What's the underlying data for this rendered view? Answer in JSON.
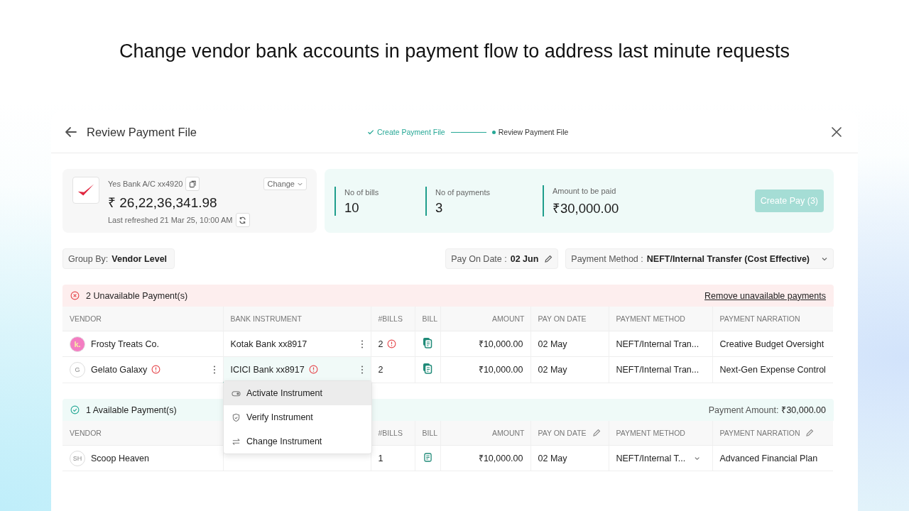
{
  "headline": "Change vendor bank accounts in payment flow to address last minute requests",
  "header": {
    "title": "Review Payment File",
    "steps": [
      {
        "label": "Create Payment File",
        "done": true
      },
      {
        "label": "Review Payment File",
        "done": false
      }
    ]
  },
  "account": {
    "name": "Yes Bank A/C xx4920",
    "balance": "₹ 26,22,36,341.98",
    "refreshed": "Last refreshed 21 Mar 25, 10:00 AM",
    "change_label": "Change"
  },
  "stats": [
    {
      "label": "No of bills",
      "value": "10"
    },
    {
      "label": "No of payments",
      "value": "3"
    },
    {
      "label": "Amount to be paid",
      "value": "₹30,000.00"
    }
  ],
  "create_button": {
    "label": "Create Pay (3)",
    "disabled": true
  },
  "filters": {
    "group_by": {
      "label": "Group By:",
      "value": "Vendor Level"
    },
    "pay_on_date": {
      "label": "Pay On Date :",
      "value": "02 Jun"
    },
    "payment_method": {
      "label": "Payment Method :",
      "value": "NEFT/Internal Transfer (Cost Effective)"
    }
  },
  "sections": [
    {
      "kind": "unavailable",
      "title": "2 Unavailable Payment(s)",
      "action": "Remove unavailable payments",
      "columns": [
        {
          "label": "VENDOR"
        },
        {
          "label": "BANK INSTRUMENT"
        },
        {
          "label": "#BILLS"
        },
        {
          "label": "BILL"
        },
        {
          "label": "AMOUNT"
        },
        {
          "label": "PAY ON DATE"
        },
        {
          "label": "PAYMENT METHOD"
        },
        {
          "label": "PAYMENT NARRATION"
        }
      ],
      "rows": [
        {
          "avatar": {
            "kind": "logo",
            "text": "k."
          },
          "vendor": "Frosty Treats Co.",
          "bank": "Kotak Bank xx8917",
          "bills": "2",
          "bills_warning": true,
          "bill": {
            "kind": "multi"
          },
          "amount": "₹10,000.00",
          "date": "02 May",
          "method": "NEFT/Internal Tran...",
          "narration": "Creative Budget Oversight"
        },
        {
          "avatar": {
            "kind": "initials",
            "text": "G"
          },
          "vendor": "Gelato Galaxy",
          "vendor_warning": true,
          "vendor_menu": true,
          "bank": "ICICI Bank xx8917",
          "bank_warning": true,
          "bank_selected": true,
          "bills": "2",
          "bill": {
            "kind": "multi"
          },
          "amount": "₹10,000.00",
          "date": "02 May",
          "method": "NEFT/Internal Tran...",
          "narration": "Next-Gen Expense Control"
        }
      ],
      "menu": [
        {
          "kind": "activate",
          "label": "Activate Instrument",
          "selected": true
        },
        {
          "kind": "verify",
          "label": "Verify Instrument",
          "selected": false
        },
        {
          "kind": "change",
          "label": "Change Instrument",
          "selected": false
        }
      ]
    },
    {
      "kind": "available",
      "title": "1 Available Payment(s)",
      "summary_label": "Payment Amount:",
      "summary_value": "₹30,000.00",
      "columns": [
        {
          "label": "VENDOR"
        },
        {},
        {
          "label": "#BILLS"
        },
        {
          "label": "BILL"
        },
        {
          "label": "AMOUNT"
        },
        {
          "label": "PAY ON DATE",
          "editable": true
        },
        {
          "label": "PAYMENT METHOD"
        },
        {
          "label": "PAYMENT NARRATION",
          "editable": true
        }
      ],
      "rows": [
        {
          "avatar": {
            "kind": "initials",
            "text": "SH"
          },
          "vendor": "Scoop Heaven",
          "bills": "1",
          "bill": {
            "kind": "single"
          },
          "amount": "₹10,000.00",
          "date": "02 May",
          "method": "NEFT/Internal T...",
          "method_dropdown": true,
          "narration": "Advanced Financial Plan"
        }
      ]
    }
  ]
}
